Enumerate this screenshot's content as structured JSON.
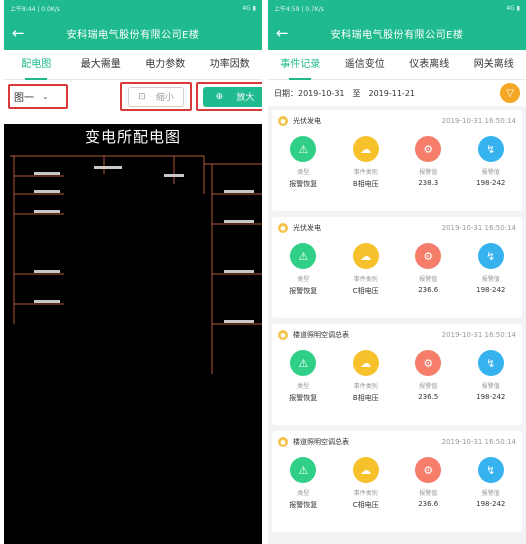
{
  "colors": {
    "accent": "#1fba8e",
    "highlight": "#d93a3a",
    "filter": "#f5a623"
  },
  "left": {
    "status": {
      "time": "上午8:44 | 0.0K/s",
      "icons": "4G ▮"
    },
    "header": {
      "back": "←",
      "title": "安科瑞电气股份有限公司E楼"
    },
    "tabs": [
      {
        "label": "配电图",
        "active": true
      },
      {
        "label": "最大需量"
      },
      {
        "label": "电力参数"
      },
      {
        "label": "功率因数"
      }
    ],
    "toolbar": {
      "select_value": "图一",
      "select_chevron": "⌄",
      "zoom_out_icon": "⊡",
      "zoom_out_label": "缩小",
      "zoom_in_icon": "⊕",
      "zoom_in_label": "放大"
    },
    "diagram": {
      "title": "变电所配电图"
    }
  },
  "right": {
    "status": {
      "time": "上午4:59 | 0.7K/s",
      "icons": "4G ▮"
    },
    "header": {
      "back": "←",
      "title": "安科瑞电气股份有限公司E楼"
    },
    "tabs": [
      {
        "label": "事件记录",
        "active": true
      },
      {
        "label": "遥信变位"
      },
      {
        "label": "仪表离线"
      },
      {
        "label": "网关离线"
      }
    ],
    "datebar": {
      "label": "日期：",
      "start": "2019-10-31",
      "to": "至",
      "end": "2019-11-21",
      "filter_icon": "▽"
    },
    "cards": [
      {
        "title": "光伏发电",
        "time": "2019-10-31 16:50:14",
        "items": [
          {
            "icon": "⚠",
            "label": "类型",
            "value": "报警恢复",
            "color": "g"
          },
          {
            "icon": "☁",
            "label": "事件类别",
            "value": "B相电压",
            "color": "y"
          },
          {
            "icon": "⚙",
            "label": "报警值",
            "value": "238.3",
            "color": "r"
          },
          {
            "icon": "↯",
            "label": "报警值",
            "value": "198-242",
            "color": "b"
          }
        ]
      },
      {
        "title": "光伏发电",
        "time": "2019-10-31 16:50:14",
        "items": [
          {
            "icon": "⚠",
            "label": "类型",
            "value": "报警恢复",
            "color": "g"
          },
          {
            "icon": "☁",
            "label": "事件类别",
            "value": "C相电压",
            "color": "y"
          },
          {
            "icon": "⚙",
            "label": "报警值",
            "value": "236.6",
            "color": "r"
          },
          {
            "icon": "↯",
            "label": "报警值",
            "value": "198-242",
            "color": "b"
          }
        ]
      },
      {
        "title": "楼道照明空调总表",
        "time": "2019-10-31 16:50:14",
        "items": [
          {
            "icon": "⚠",
            "label": "类型",
            "value": "报警恢复",
            "color": "g"
          },
          {
            "icon": "☁",
            "label": "事件类别",
            "value": "B相电压",
            "color": "y"
          },
          {
            "icon": "⚙",
            "label": "报警值",
            "value": "236.5",
            "color": "r"
          },
          {
            "icon": "↯",
            "label": "报警值",
            "value": "198-242",
            "color": "b"
          }
        ]
      },
      {
        "title": "楼道照明空调总表",
        "time": "2019-10-31 16:50:14",
        "items": [
          {
            "icon": "⚠",
            "label": "类型",
            "value": "报警恢复",
            "color": "g"
          },
          {
            "icon": "☁",
            "label": "事件类别",
            "value": "C相电压",
            "color": "y"
          },
          {
            "icon": "⚙",
            "label": "报警值",
            "value": "236.6",
            "color": "r"
          },
          {
            "icon": "↯",
            "label": "报警值",
            "value": "198-242",
            "color": "b"
          }
        ]
      }
    ]
  }
}
